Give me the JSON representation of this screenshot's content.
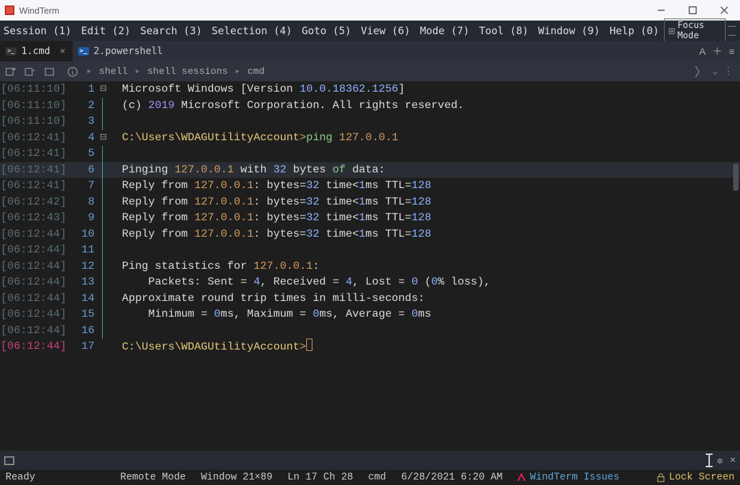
{
  "app": {
    "title": "WindTerm"
  },
  "menu": {
    "items": [
      "Session (1)",
      "Edit (2)",
      "Search (3)",
      "Selection (4)",
      "Goto (5)",
      "View (6)",
      "Mode (7)",
      "Tool (8)",
      "Window (9)",
      "Help (0)"
    ],
    "focus_mode": "Focus Mode"
  },
  "tabs": {
    "t1": {
      "label": "1.cmd",
      "icon": ">_",
      "kind": "cmd"
    },
    "t2": {
      "label": "2.powershell",
      "icon": ">_",
      "kind": "ps"
    },
    "right_A": "A"
  },
  "breadcrumb": {
    "b1": "shell",
    "b2": "shell sessions",
    "b3": "cmd"
  },
  "terminal": {
    "rows": [
      {
        "ts": "[06:11:10]",
        "ln": "1",
        "fold": "⊟",
        "segments": [
          {
            "t": "Microsoft Windows [Version ",
            "c": ""
          },
          {
            "t": "10.0.18362.1256",
            "c": "c-blue"
          },
          {
            "t": "]",
            "c": ""
          }
        ]
      },
      {
        "ts": "[06:11:10]",
        "ln": "2",
        "segments": [
          {
            "t": "(c) ",
            "c": ""
          },
          {
            "t": "2019",
            "c": "c-purple"
          },
          {
            "t": " Microsoft Corporation. All rights reserved.",
            "c": ""
          }
        ]
      },
      {
        "ts": "[06:11:10]",
        "ln": "3",
        "segments": []
      },
      {
        "ts": "[06:12:41]",
        "ln": "4",
        "fold": "⊟",
        "segments": [
          {
            "t": "C:\\Users\\WDAGUtilityAccount",
            "c": "c-yellow"
          },
          {
            "t": ">",
            "c": "c-orange"
          },
          {
            "t": "ping ",
            "c": "c-green"
          },
          {
            "t": "127.0.0.1",
            "c": "c-orange"
          }
        ]
      },
      {
        "ts": "[06:12:41]",
        "ln": "5",
        "segments": []
      },
      {
        "ts": "[06:12:41]",
        "ln": "6",
        "hl": true,
        "segments": [
          {
            "t": "Pinging ",
            "c": ""
          },
          {
            "t": "127.0.0.1",
            "c": "c-orange"
          },
          {
            "t": " with ",
            "c": ""
          },
          {
            "t": "32",
            "c": "c-blue"
          },
          {
            "t": " bytes ",
            "c": ""
          },
          {
            "t": "of",
            "c": "c-green"
          },
          {
            "t": " data:",
            "c": ""
          }
        ]
      },
      {
        "ts": "[06:12:41]",
        "ln": "7",
        "segments": [
          {
            "t": "Reply from ",
            "c": ""
          },
          {
            "t": "127.0.0.1",
            "c": "c-orange"
          },
          {
            "t": ": bytes=",
            "c": ""
          },
          {
            "t": "32",
            "c": "c-blue"
          },
          {
            "t": " time<",
            "c": ""
          },
          {
            "t": "1",
            "c": "c-blue"
          },
          {
            "t": "ms TTL=",
            "c": ""
          },
          {
            "t": "128",
            "c": "c-blue"
          }
        ]
      },
      {
        "ts": "[06:12:42]",
        "ln": "8",
        "segments": [
          {
            "t": "Reply from ",
            "c": ""
          },
          {
            "t": "127.0.0.1",
            "c": "c-orange"
          },
          {
            "t": ": bytes=",
            "c": ""
          },
          {
            "t": "32",
            "c": "c-blue"
          },
          {
            "t": " time<",
            "c": ""
          },
          {
            "t": "1",
            "c": "c-blue"
          },
          {
            "t": "ms TTL=",
            "c": ""
          },
          {
            "t": "128",
            "c": "c-blue"
          }
        ]
      },
      {
        "ts": "[06:12:43]",
        "ln": "9",
        "segments": [
          {
            "t": "Reply from ",
            "c": ""
          },
          {
            "t": "127.0.0.1",
            "c": "c-orange"
          },
          {
            "t": ": bytes=",
            "c": ""
          },
          {
            "t": "32",
            "c": "c-blue"
          },
          {
            "t": " time<",
            "c": ""
          },
          {
            "t": "1",
            "c": "c-blue"
          },
          {
            "t": "ms TTL=",
            "c": ""
          },
          {
            "t": "128",
            "c": "c-blue"
          }
        ]
      },
      {
        "ts": "[06:12:44]",
        "ln": "10",
        "segments": [
          {
            "t": "Reply from ",
            "c": ""
          },
          {
            "t": "127.0.0.1",
            "c": "c-orange"
          },
          {
            "t": ": bytes=",
            "c": ""
          },
          {
            "t": "32",
            "c": "c-blue"
          },
          {
            "t": " time<",
            "c": ""
          },
          {
            "t": "1",
            "c": "c-blue"
          },
          {
            "t": "ms TTL=",
            "c": ""
          },
          {
            "t": "128",
            "c": "c-blue"
          }
        ]
      },
      {
        "ts": "[06:12:44]",
        "ln": "11",
        "segments": []
      },
      {
        "ts": "[06:12:44]",
        "ln": "12",
        "segments": [
          {
            "t": "Ping statistics for ",
            "c": ""
          },
          {
            "t": "127.0.0.1",
            "c": "c-orange"
          },
          {
            "t": ":",
            "c": ""
          }
        ]
      },
      {
        "ts": "[06:12:44]",
        "ln": "13",
        "segments": [
          {
            "t": "    Packets: Sent = ",
            "c": ""
          },
          {
            "t": "4",
            "c": "c-blue"
          },
          {
            "t": ", Received = ",
            "c": ""
          },
          {
            "t": "4",
            "c": "c-blue"
          },
          {
            "t": ", Lost = ",
            "c": ""
          },
          {
            "t": "0",
            "c": "c-blue"
          },
          {
            "t": " (",
            "c": ""
          },
          {
            "t": "0",
            "c": "c-blue"
          },
          {
            "t": "% loss),",
            "c": ""
          }
        ]
      },
      {
        "ts": "[06:12:44]",
        "ln": "14",
        "segments": [
          {
            "t": "Approximate round trip times in milli-seconds:",
            "c": ""
          }
        ]
      },
      {
        "ts": "[06:12:44]",
        "ln": "15",
        "segments": [
          {
            "t": "    Minimum = ",
            "c": ""
          },
          {
            "t": "0",
            "c": "c-blue"
          },
          {
            "t": "ms, Maximum = ",
            "c": ""
          },
          {
            "t": "0",
            "c": "c-blue"
          },
          {
            "t": "ms, Average = ",
            "c": ""
          },
          {
            "t": "0",
            "c": "c-blue"
          },
          {
            "t": "ms",
            "c": ""
          }
        ]
      },
      {
        "ts": "[06:12:44]",
        "ln": "16",
        "segments": []
      },
      {
        "ts": "[06:12:44]",
        "ln": "17",
        "active": true,
        "cursor": true,
        "no_indent_line": true,
        "segments": [
          {
            "t": "C:\\Users\\WDAGUtilityAccount",
            "c": "c-yellow"
          },
          {
            "t": ">",
            "c": "c-orange"
          }
        ]
      }
    ]
  },
  "status": {
    "ready": "Ready",
    "remote_mode": "Remote Mode",
    "window": "Window 21×89",
    "cursor": "Ln 17 Ch 28",
    "shell": "cmd",
    "datetime": "6/28/2021 6:20 AM",
    "issues": "WindTerm Issues",
    "lock": "Lock Screen"
  }
}
